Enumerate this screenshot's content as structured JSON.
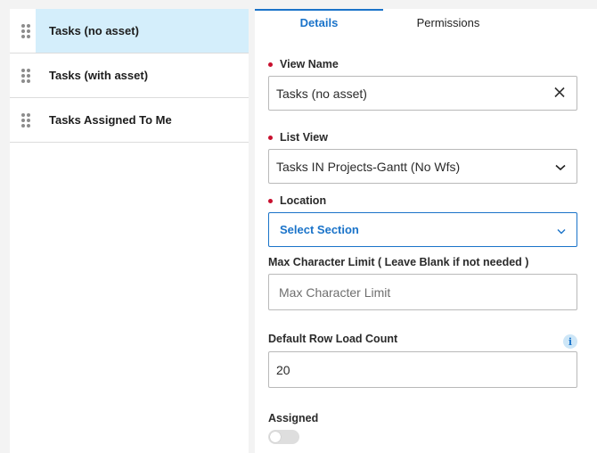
{
  "views": [
    {
      "label": "Tasks (no asset)",
      "active": true
    },
    {
      "label": "Tasks (with asset)",
      "active": false
    },
    {
      "label": "Tasks Assigned To Me",
      "active": false
    }
  ],
  "tabs": {
    "details": "Details",
    "permissions": "Permissions"
  },
  "form": {
    "view_name": {
      "label": "View Name",
      "value": "Tasks (no asset)",
      "required": true
    },
    "list_view": {
      "label": "List View",
      "value": "Tasks IN Projects-Gantt (No Wfs)",
      "required": true
    },
    "location": {
      "label": "Location",
      "value": "Select Section",
      "required": true
    },
    "max_char_limit": {
      "label": "Max Character Limit ( Leave Blank if not needed )",
      "placeholder": "Max Character Limit"
    },
    "default_row_load_count": {
      "label": "Default Row Load Count",
      "value": "20",
      "info_icon": "i"
    },
    "assigned": {
      "label": "Assigned",
      "enabled": false
    }
  },
  "colors": {
    "accent": "#1a73c9",
    "required": "#c8102e",
    "active_row": "#d4eefb"
  },
  "icons": [
    "drag-handle-icon",
    "clear-icon",
    "chevron-down-icon",
    "info-icon"
  ]
}
